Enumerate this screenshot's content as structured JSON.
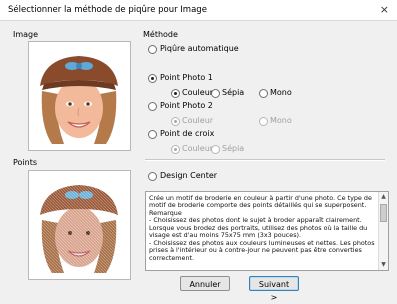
{
  "window": {
    "title": "Sélectionner la méthode de piqûre pour Image",
    "close_glyph": "×"
  },
  "image_section": {
    "label": "Image"
  },
  "points_section": {
    "label": "Points"
  },
  "method": {
    "label": "Méthode",
    "auto": "Piqûre automatique",
    "photo1": "Point Photo 1",
    "photo1_color": "Couleur",
    "photo1_sepia": "Sépia",
    "photo1_mono": "Mono",
    "photo2": "Point Photo 2",
    "photo2_color": "Couleur",
    "photo2_mono": "Mono",
    "cross": "Point de croix",
    "cross_color": "Couleur",
    "cross_sepia": "Sépia",
    "design_center": "Design Center",
    "selected": "Point Photo 1",
    "selected_color_mode": "Couleur"
  },
  "description": "Crée un motif de broderie en couleur à partir d'une photo. Ce type de motif de broderie comporte des points détaillés qui se superposent.\nRemarque\n- Choisissez des photos dont le sujet à broder apparaît clairement. Lorsque vous brodez des portraits, utilisez des photos où la taille du visage est d'au moins 75x75 mm (3x3 pouces).\n- Choisissez des photos aux couleurs lumineuses et nettes. Les photos prises à l'intérieur ou à contre-jour ne peuvent pas être converties correctement.",
  "buttons": {
    "cancel": "Annuler",
    "next": "Suivant >"
  },
  "colors": {
    "accent": "#3c7fb1",
    "hat": "#8a4a2c",
    "bow": "#5fa8d8"
  }
}
